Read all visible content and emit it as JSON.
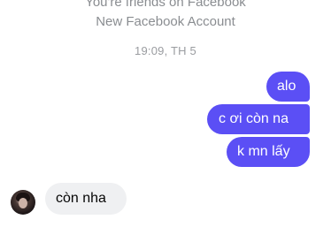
{
  "chat": {
    "system_line_1": "You're friends on Facebook",
    "system_line_2": "New Facebook Account",
    "timestamp": "19:09, TH 5",
    "messages": [
      {
        "from": "me",
        "text": "alo"
      },
      {
        "from": "me",
        "text": "c ơi còn na"
      },
      {
        "from": "me",
        "text": "k mn lấy"
      },
      {
        "from": "contact",
        "text": "còn nha"
      }
    ]
  },
  "colors": {
    "outgoing_bubble": "#5b4ff5",
    "incoming_bubble": "#eff0f2",
    "system_text": "#8a8d91"
  },
  "icons": {
    "contact_avatar": "contact-avatar-photo"
  }
}
